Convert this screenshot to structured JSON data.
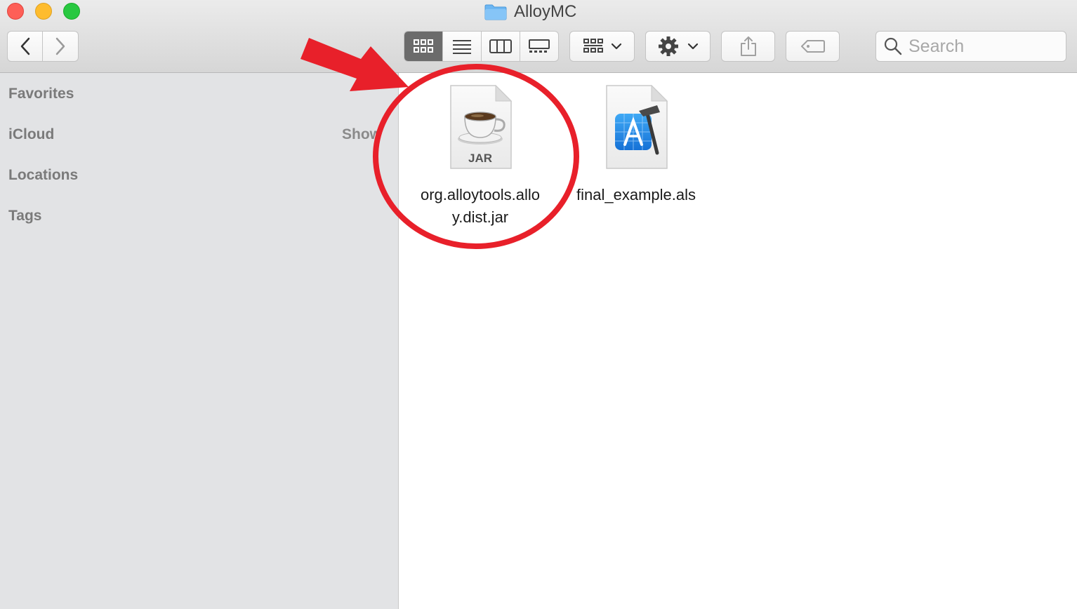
{
  "window": {
    "title": "AlloyMC",
    "title_icon": "folder-icon"
  },
  "toolbar": {
    "back_icon": "chevron-left-icon",
    "forward_icon": "chevron-right-icon",
    "views": [
      {
        "name": "icon-view-icon",
        "active": true
      },
      {
        "name": "list-view-icon",
        "active": false
      },
      {
        "name": "column-view-icon",
        "active": false
      },
      {
        "name": "gallery-view-icon",
        "active": false
      }
    ],
    "group_icon": "group-by-icon",
    "action_icon": "gear-icon",
    "share_icon": "share-icon",
    "tag_icon": "tag-icon",
    "search_placeholder": "Search"
  },
  "sidebar": {
    "sections": [
      {
        "label": "Favorites"
      },
      {
        "label": "iCloud"
      },
      {
        "label": "Locations"
      },
      {
        "label": "Tags"
      }
    ],
    "show_label": "Show"
  },
  "files": [
    {
      "name_line1": "org.alloytools.allo",
      "name_line2": "y.dist.jar",
      "icon": "jar-file-icon",
      "badge": "JAR"
    },
    {
      "name_line1": "final_example.als",
      "icon": "xcode-document-icon"
    }
  ],
  "colors": {
    "annotation_red": "#e8202a",
    "traffic_close": "#fe5f57",
    "traffic_min": "#febc2e",
    "traffic_max": "#28c840",
    "folder_blue": "#6cb6f2"
  }
}
